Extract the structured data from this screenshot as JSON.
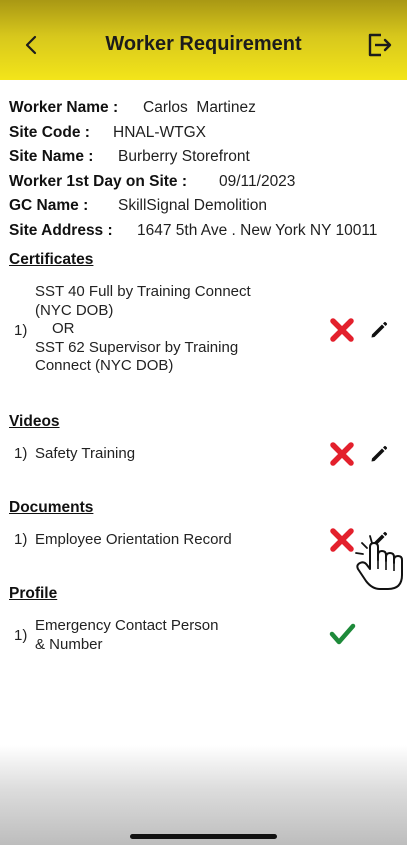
{
  "header": {
    "title": "Worker Requirement",
    "back_icon": "chevron-left-icon",
    "logout_icon": "logout-icon",
    "bg_color": "#e8d81c"
  },
  "worker_info": {
    "worker_name_label": "Worker Name :",
    "worker_name": "Carlos  Martinez",
    "site_code_label": "Site Code :",
    "site_code": "HNAL-WTGX",
    "site_name_label": "Site Name :",
    "site_name": "Burberry Storefront",
    "first_day_label": "Worker 1st Day on Site :",
    "first_day": "09/11/2023",
    "gc_name_label": "GC Name :",
    "gc_name": "SkillSignal Demolition",
    "site_address_label": "Site Address :",
    "site_address": "1647 5th Ave . New York NY 10011"
  },
  "sections": {
    "certificates": {
      "title": "Certificates",
      "item_number": "1)",
      "line1": "SST 40 Full by Training Connect",
      "line2": "(NYC DOB)",
      "or_text": "OR",
      "line3": "SST 62 Supervisor by Training",
      "line4": "Connect (NYC DOB)",
      "status": "incomplete"
    },
    "videos": {
      "title": "Videos",
      "item_number": "1)",
      "label": "Safety Training",
      "status": "incomplete"
    },
    "documents": {
      "title": "Documents",
      "item_number": "1)",
      "label": "Employee Orientation Record",
      "status": "incomplete"
    },
    "profile": {
      "title": "Profile",
      "item_number": "1)",
      "line1": "Emergency Contact Person",
      "line2": "& Number",
      "status": "complete"
    }
  },
  "colors": {
    "incomplete": "#e3202c",
    "complete": "#1e8a3a"
  },
  "icons": {
    "status_incomplete": "x-mark-icon",
    "status_complete": "check-icon",
    "edit": "pencil-icon",
    "pointer": "tap-hand-icon"
  }
}
